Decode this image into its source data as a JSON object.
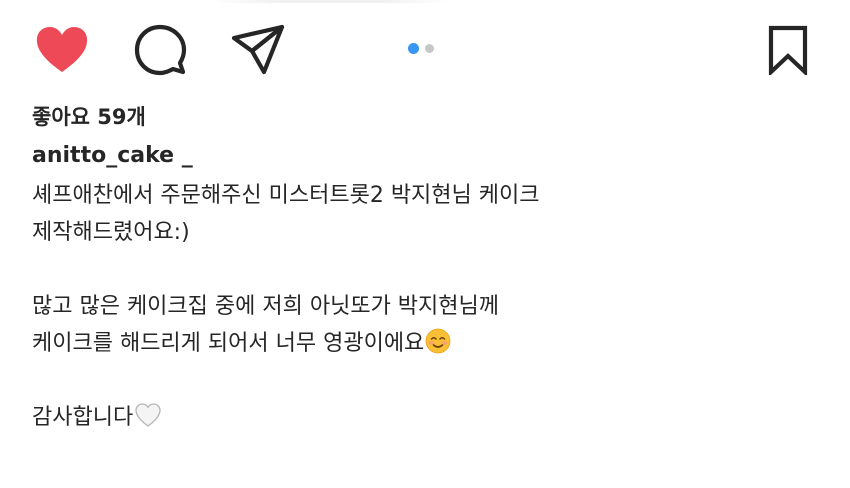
{
  "actions": {
    "like": {
      "icon": "heart-filled-icon",
      "liked": true,
      "color": "#ed4956"
    },
    "comment": {
      "icon": "comment-bubble-icon"
    },
    "share": {
      "icon": "paper-plane-icon"
    },
    "save": {
      "icon": "bookmark-icon"
    }
  },
  "carousel": {
    "total": 2,
    "active_index": 0,
    "active_color": "#3897f0",
    "inactive_color": "#c7c7c7"
  },
  "post": {
    "likes_text": "좋아요 59개",
    "username": "anitto_cake _",
    "caption_lines": [
      "셰프애찬에서 주문해주신 미스터트롯2 박지현님 케이크",
      "제작해드렸어요:)",
      "",
      "많고 많은 케이크집 중에 저희 아닛또가 박지현님께",
      "케이크를 해드리게 되어서 너무 영광이에요",
      "",
      "감사합니다"
    ],
    "emojis": {
      "line_4": "smiling-face-emoji",
      "line_6": "white-heart-emoji"
    }
  }
}
